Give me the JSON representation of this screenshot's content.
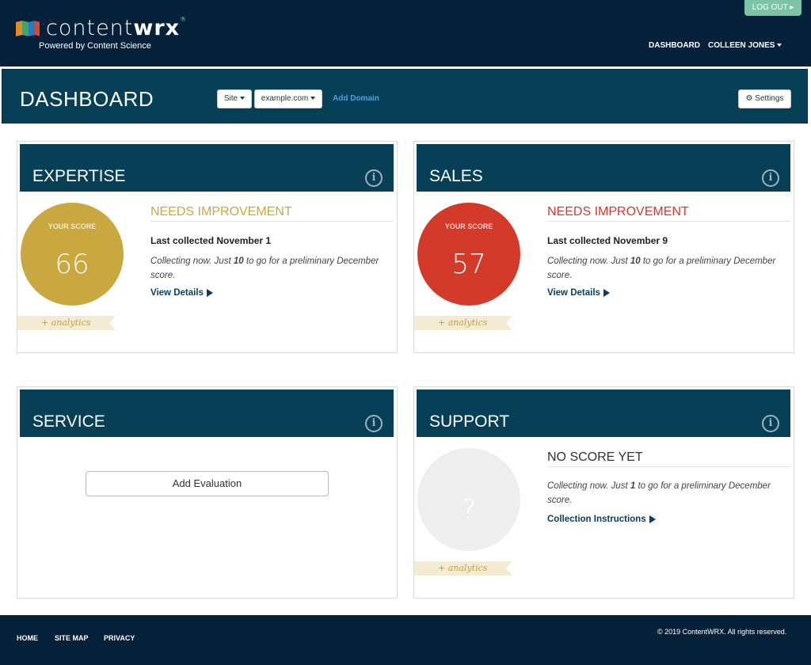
{
  "header": {
    "logo_prefix": "content",
    "logo_suffix": "wrx",
    "logo_reg": "®",
    "tagline": "Powered by Content Science",
    "logout_label": "LOG OUT ▸",
    "nav_dashboard": "DASHBOARD",
    "nav_user": "COLLEEN JONES"
  },
  "dashboard": {
    "title": "DASHBOARD",
    "site_select": "Site",
    "domain_select": "example.com",
    "add_domain": "Add Domain",
    "settings": "Settings"
  },
  "cards": [
    {
      "title": "EXPERTISE",
      "score_label": "YOUR SCORE",
      "score": "66",
      "color": "#c9a83f",
      "status": "NEEDS IMPROVEMENT",
      "status_color": "#c9a83f",
      "collected": "Last collected November 1",
      "desc_pre": "Collecting now. Just ",
      "desc_num": "10",
      "desc_post": " to go for a preliminary December score.",
      "link": "View Details",
      "analytics": "+ analytics"
    },
    {
      "title": "SALES",
      "score_label": "YOUR SCORE",
      "score": "57",
      "color": "#d33a2a",
      "status": "NEEDS IMPROVEMENT",
      "status_color": "#d33a2a",
      "collected": "Last collected November 9",
      "desc_pre": "Collecting now. Just ",
      "desc_num": "10",
      "desc_post": " to go for a preliminary December score.",
      "link": "View Details",
      "analytics": "+ analytics"
    },
    {
      "title": "SERVICE",
      "add_evaluation": "Add Evaluation"
    },
    {
      "title": "SUPPORT",
      "score": "?",
      "color": "#eeeeee",
      "status": "NO SCORE YET",
      "status_color": "#333333",
      "desc_pre": "Collecting now. Just ",
      "desc_num": "1",
      "desc_post": " to go for a preliminary December score.",
      "link": "Collection Instructions",
      "analytics": "+ analytics"
    }
  ],
  "footer": {
    "home": "HOME",
    "sitemap": "SITE MAP",
    "privacy": "PRIVACY",
    "copyright": "© 2019 ContentWRX. All rights reserved."
  },
  "icons": {
    "info": "info-icon",
    "gear": "gear-icon",
    "caret": "caret-down-icon",
    "play": "play-arrow-icon"
  }
}
